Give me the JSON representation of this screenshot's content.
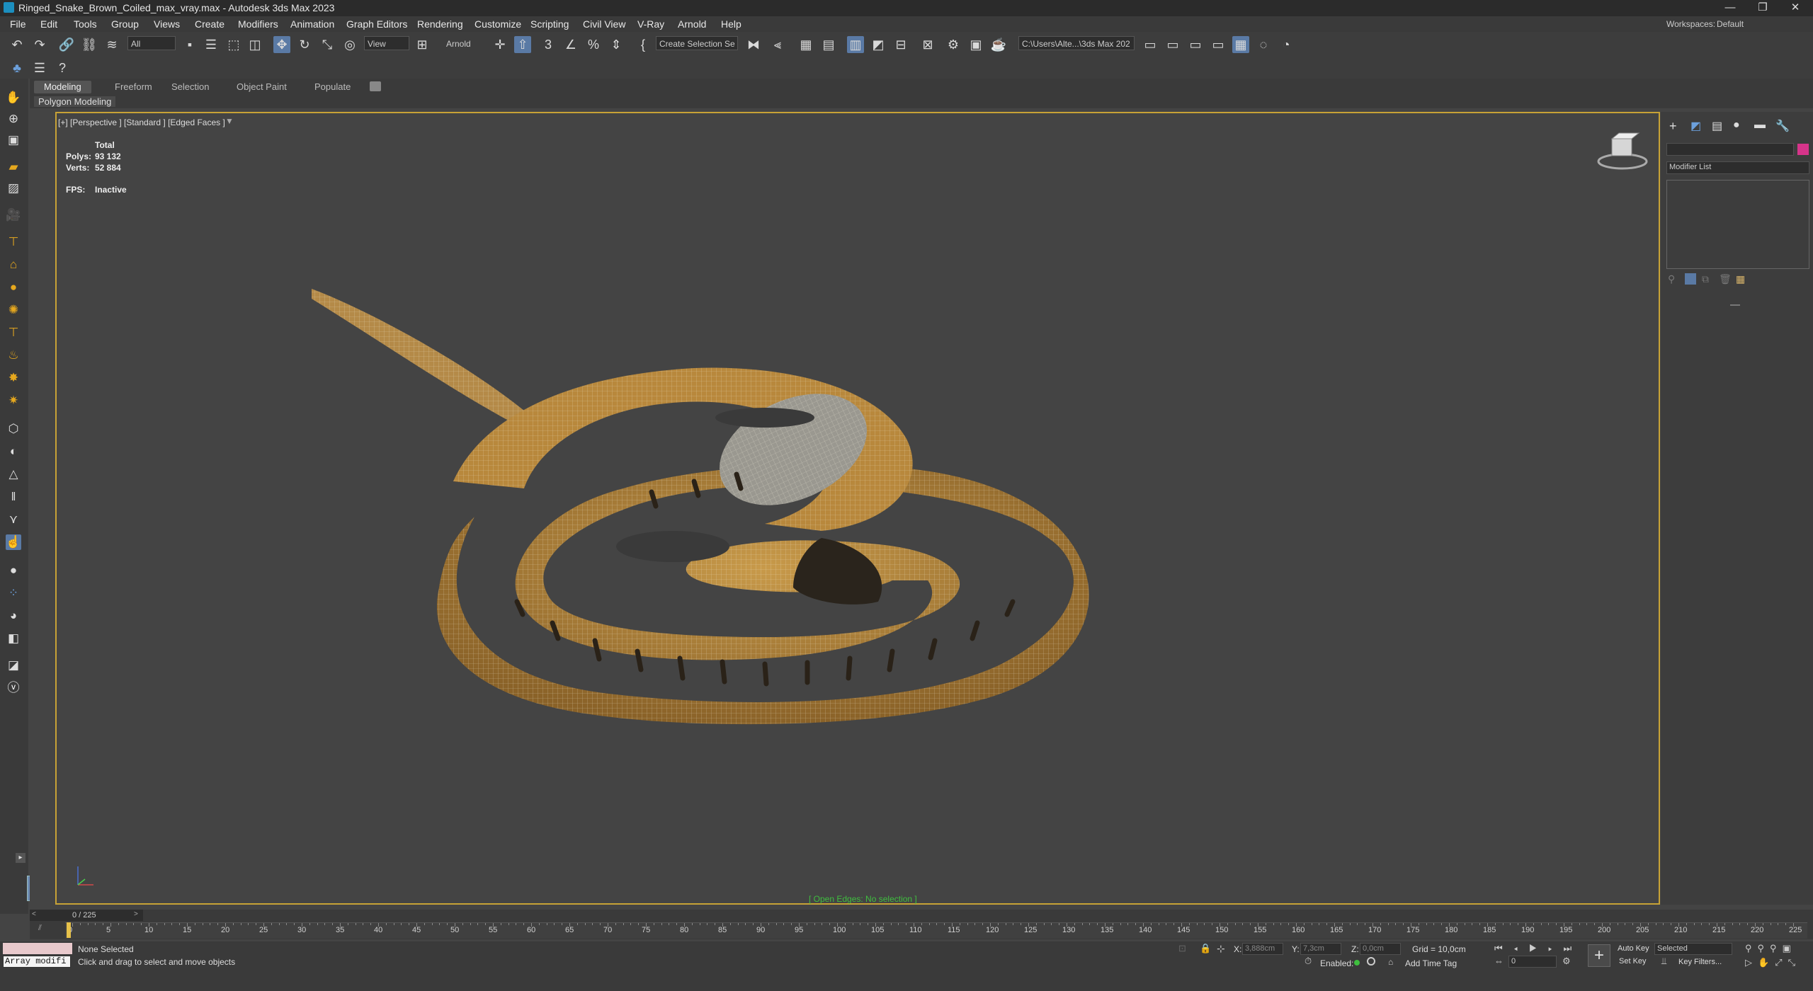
{
  "window": {
    "title": "Ringed_Snake_Brown_Coiled_max_vray.max - Autodesk 3ds Max 2023",
    "minimize": "—",
    "restore": "❐",
    "close": "✕"
  },
  "menu": [
    "File",
    "Edit",
    "Tools",
    "Group",
    "Views",
    "Create",
    "Modifiers",
    "Animation",
    "Graph Editors",
    "Rendering",
    "Customize",
    "Scripting",
    "Civil View",
    "V-Ray",
    "Arnold",
    "Help"
  ],
  "workspace": {
    "label": "Workspaces:",
    "value": "Default"
  },
  "toolbar": {
    "selection_filter": "All",
    "reference_coord": "View",
    "renderer": "Arnold",
    "named_selection": "Create Selection Se",
    "project_path": "C:\\Users\\Alte...\\3ds Max 202"
  },
  "ribbon": {
    "tabs": [
      "Modeling",
      "Freeform",
      "Selection",
      "Object Paint",
      "Populate"
    ],
    "active_tab": "Modeling",
    "panel": "Polygon Modeling"
  },
  "viewport": {
    "label": "[+] [Perspective ] [Standard ] [Edged Faces ]",
    "stats": {
      "header": "Total",
      "polys_label": "Polys:",
      "polys": "93 132",
      "verts_label": "Verts:",
      "verts": "52 884",
      "fps_label": "FPS:",
      "fps": "Inactive"
    },
    "open_edges": "[ Open Edges: No selection ]"
  },
  "command_panel": {
    "modifier_list": "Modifier List"
  },
  "timeline": {
    "frame": "0 / 225",
    "ticks": [
      "0",
      "5",
      "10",
      "15",
      "20",
      "25",
      "30",
      "35",
      "40",
      "45",
      "50",
      "55",
      "60",
      "65",
      "70",
      "75",
      "80",
      "85",
      "90",
      "95",
      "100",
      "105",
      "110",
      "115",
      "120",
      "125",
      "130",
      "135",
      "140",
      "145",
      "150",
      "155",
      "160",
      "165",
      "170",
      "175",
      "180",
      "185",
      "190",
      "195",
      "200",
      "205",
      "210",
      "215",
      "220",
      "225"
    ],
    "current_fraction": 0
  },
  "status": {
    "maxscript": "Array modifi",
    "selection": "None Selected",
    "prompt": "Click and drag to select and move objects",
    "x_label": "X:",
    "x_value": "3,888cm",
    "y_label": "Y:",
    "y_value": "7,3cm",
    "z_label": "Z:",
    "z_value": "0,0cm",
    "grid": "Grid = 10,0cm",
    "enabled": "Enabled:",
    "add_time_tag": "Add Time Tag",
    "auto_key": "Auto Key",
    "set_key": "Set Key",
    "key_mode": "Selected",
    "key_filters": "Key Filters...",
    "frame_field": "0"
  },
  "colors": {
    "viewport_border": "#c7a236",
    "snake_body": "#b98a3c",
    "wire": "#e8e2d0",
    "open_edges": "#3fbf3f"
  }
}
